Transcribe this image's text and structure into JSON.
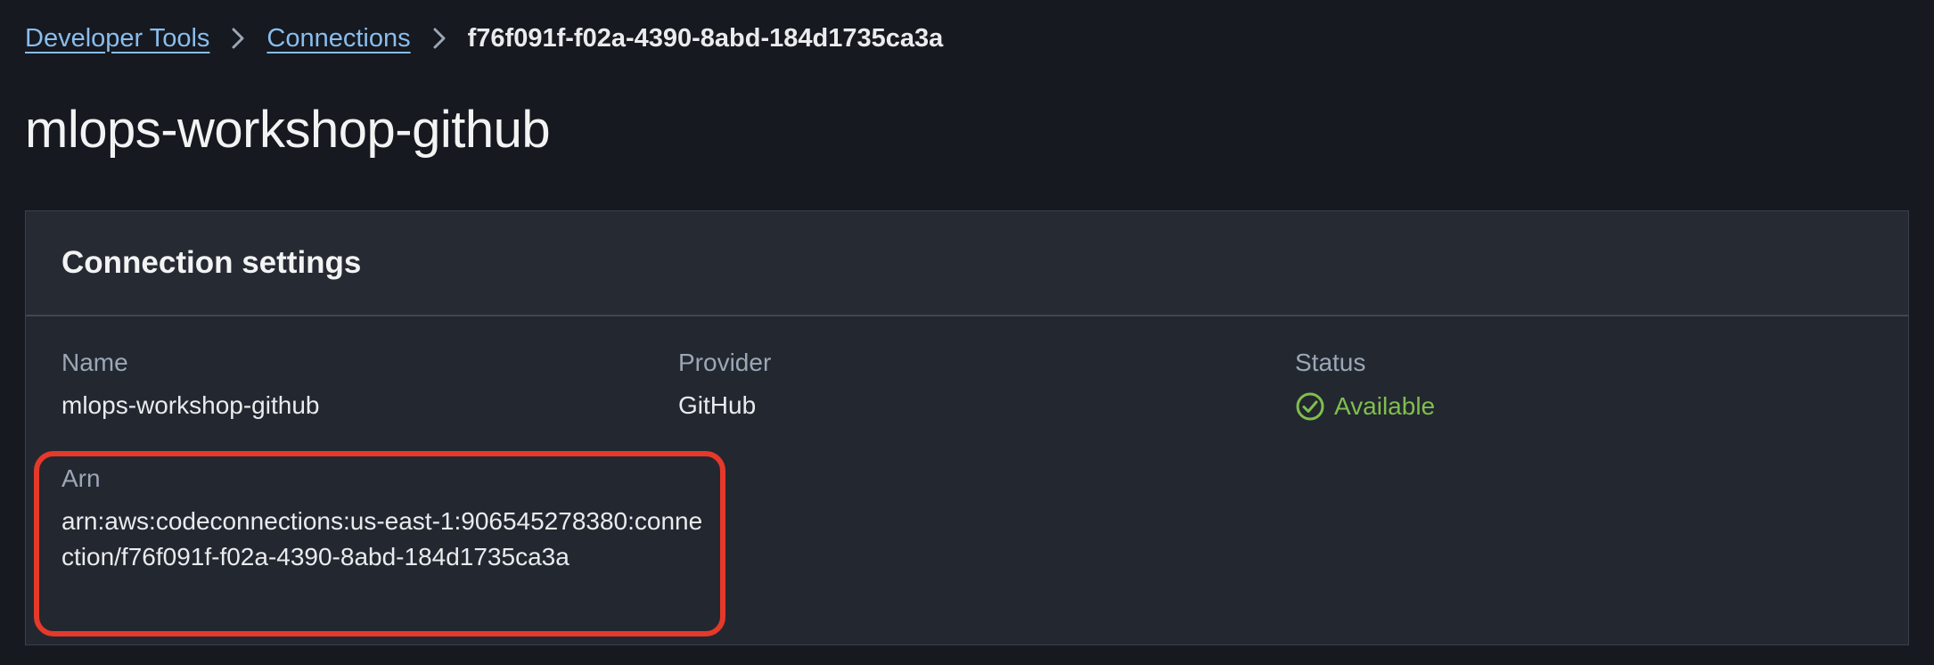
{
  "breadcrumb": {
    "items": [
      {
        "label": "Developer Tools"
      },
      {
        "label": "Connections"
      }
    ],
    "current": "f76f091f-f02a-4390-8abd-184d1735ca3a"
  },
  "page": {
    "title": "mlops-workshop-github"
  },
  "connection_settings": {
    "title": "Connection settings",
    "name_label": "Name",
    "name_value": "mlops-workshop-github",
    "provider_label": "Provider",
    "provider_value": "GitHub",
    "status_label": "Status",
    "status_value": "Available",
    "status_icon": "check-circle-icon",
    "arn_label": "Arn",
    "arn_value": "arn:aws:codeconnections:us-east-1:906545278380:connection/f76f091f-f02a-4390-8abd-184d1735ca3a"
  },
  "colors": {
    "background": "#16191f",
    "panel": "#232730",
    "link": "#89bdee",
    "status_success": "#7fbf4d",
    "highlight": "#e5392a"
  }
}
